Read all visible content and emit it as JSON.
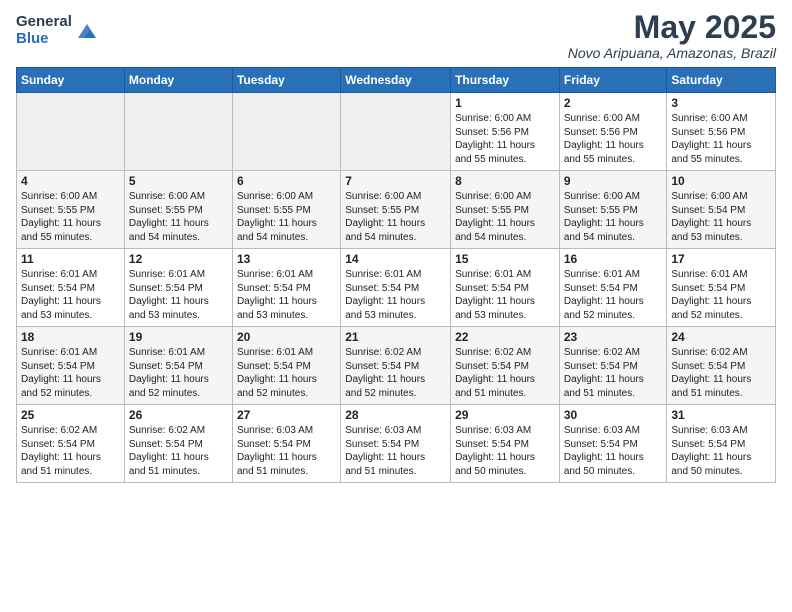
{
  "header": {
    "logo_general": "General",
    "logo_blue": "Blue",
    "month_title": "May 2025",
    "location": "Novo Aripuana, Amazonas, Brazil"
  },
  "days_of_week": [
    "Sunday",
    "Monday",
    "Tuesday",
    "Wednesday",
    "Thursday",
    "Friday",
    "Saturday"
  ],
  "weeks": [
    [
      {
        "day": "",
        "info": ""
      },
      {
        "day": "",
        "info": ""
      },
      {
        "day": "",
        "info": ""
      },
      {
        "day": "",
        "info": ""
      },
      {
        "day": "1",
        "info": "Sunrise: 6:00 AM\nSunset: 5:56 PM\nDaylight: 11 hours\nand 55 minutes."
      },
      {
        "day": "2",
        "info": "Sunrise: 6:00 AM\nSunset: 5:56 PM\nDaylight: 11 hours\nand 55 minutes."
      },
      {
        "day": "3",
        "info": "Sunrise: 6:00 AM\nSunset: 5:56 PM\nDaylight: 11 hours\nand 55 minutes."
      }
    ],
    [
      {
        "day": "4",
        "info": "Sunrise: 6:00 AM\nSunset: 5:55 PM\nDaylight: 11 hours\nand 55 minutes."
      },
      {
        "day": "5",
        "info": "Sunrise: 6:00 AM\nSunset: 5:55 PM\nDaylight: 11 hours\nand 54 minutes."
      },
      {
        "day": "6",
        "info": "Sunrise: 6:00 AM\nSunset: 5:55 PM\nDaylight: 11 hours\nand 54 minutes."
      },
      {
        "day": "7",
        "info": "Sunrise: 6:00 AM\nSunset: 5:55 PM\nDaylight: 11 hours\nand 54 minutes."
      },
      {
        "day": "8",
        "info": "Sunrise: 6:00 AM\nSunset: 5:55 PM\nDaylight: 11 hours\nand 54 minutes."
      },
      {
        "day": "9",
        "info": "Sunrise: 6:00 AM\nSunset: 5:55 PM\nDaylight: 11 hours\nand 54 minutes."
      },
      {
        "day": "10",
        "info": "Sunrise: 6:00 AM\nSunset: 5:54 PM\nDaylight: 11 hours\nand 53 minutes."
      }
    ],
    [
      {
        "day": "11",
        "info": "Sunrise: 6:01 AM\nSunset: 5:54 PM\nDaylight: 11 hours\nand 53 minutes."
      },
      {
        "day": "12",
        "info": "Sunrise: 6:01 AM\nSunset: 5:54 PM\nDaylight: 11 hours\nand 53 minutes."
      },
      {
        "day": "13",
        "info": "Sunrise: 6:01 AM\nSunset: 5:54 PM\nDaylight: 11 hours\nand 53 minutes."
      },
      {
        "day": "14",
        "info": "Sunrise: 6:01 AM\nSunset: 5:54 PM\nDaylight: 11 hours\nand 53 minutes."
      },
      {
        "day": "15",
        "info": "Sunrise: 6:01 AM\nSunset: 5:54 PM\nDaylight: 11 hours\nand 53 minutes."
      },
      {
        "day": "16",
        "info": "Sunrise: 6:01 AM\nSunset: 5:54 PM\nDaylight: 11 hours\nand 52 minutes."
      },
      {
        "day": "17",
        "info": "Sunrise: 6:01 AM\nSunset: 5:54 PM\nDaylight: 11 hours\nand 52 minutes."
      }
    ],
    [
      {
        "day": "18",
        "info": "Sunrise: 6:01 AM\nSunset: 5:54 PM\nDaylight: 11 hours\nand 52 minutes."
      },
      {
        "day": "19",
        "info": "Sunrise: 6:01 AM\nSunset: 5:54 PM\nDaylight: 11 hours\nand 52 minutes."
      },
      {
        "day": "20",
        "info": "Sunrise: 6:01 AM\nSunset: 5:54 PM\nDaylight: 11 hours\nand 52 minutes."
      },
      {
        "day": "21",
        "info": "Sunrise: 6:02 AM\nSunset: 5:54 PM\nDaylight: 11 hours\nand 52 minutes."
      },
      {
        "day": "22",
        "info": "Sunrise: 6:02 AM\nSunset: 5:54 PM\nDaylight: 11 hours\nand 51 minutes."
      },
      {
        "day": "23",
        "info": "Sunrise: 6:02 AM\nSunset: 5:54 PM\nDaylight: 11 hours\nand 51 minutes."
      },
      {
        "day": "24",
        "info": "Sunrise: 6:02 AM\nSunset: 5:54 PM\nDaylight: 11 hours\nand 51 minutes."
      }
    ],
    [
      {
        "day": "25",
        "info": "Sunrise: 6:02 AM\nSunset: 5:54 PM\nDaylight: 11 hours\nand 51 minutes."
      },
      {
        "day": "26",
        "info": "Sunrise: 6:02 AM\nSunset: 5:54 PM\nDaylight: 11 hours\nand 51 minutes."
      },
      {
        "day": "27",
        "info": "Sunrise: 6:03 AM\nSunset: 5:54 PM\nDaylight: 11 hours\nand 51 minutes."
      },
      {
        "day": "28",
        "info": "Sunrise: 6:03 AM\nSunset: 5:54 PM\nDaylight: 11 hours\nand 51 minutes."
      },
      {
        "day": "29",
        "info": "Sunrise: 6:03 AM\nSunset: 5:54 PM\nDaylight: 11 hours\nand 50 minutes."
      },
      {
        "day": "30",
        "info": "Sunrise: 6:03 AM\nSunset: 5:54 PM\nDaylight: 11 hours\nand 50 minutes."
      },
      {
        "day": "31",
        "info": "Sunrise: 6:03 AM\nSunset: 5:54 PM\nDaylight: 11 hours\nand 50 minutes."
      }
    ]
  ]
}
